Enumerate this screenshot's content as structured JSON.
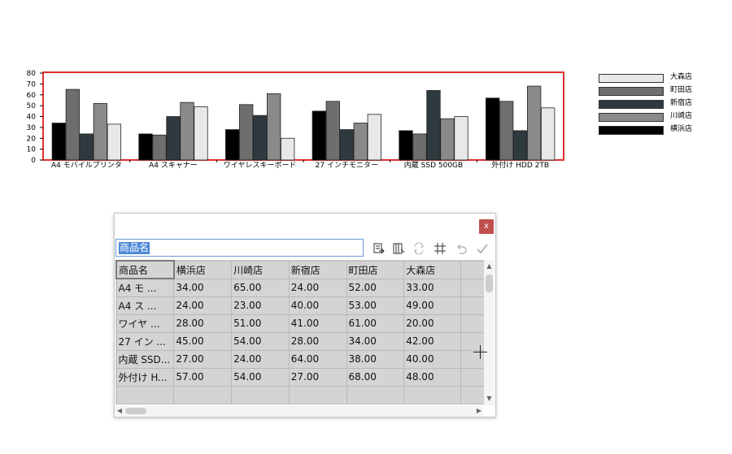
{
  "chart_data": {
    "type": "bar",
    "categories": [
      "A4 モバイルプリンタ",
      "A4 スキャナー",
      "ワイヤレスキーボード",
      "27 インチモニター",
      "内蔵 SSD 500GB",
      "外付け HDD 2TB"
    ],
    "series": [
      {
        "name": "横浜店",
        "values": [
          34,
          24,
          28,
          45,
          27,
          57
        ],
        "color": "#000000"
      },
      {
        "name": "川崎店",
        "values": [
          65,
          23,
          51,
          54,
          24,
          54
        ],
        "color": "#6e6e6e"
      },
      {
        "name": "新宿店",
        "values": [
          24,
          40,
          41,
          28,
          64,
          27
        ],
        "color": "#2f3a3f"
      },
      {
        "name": "町田店",
        "values": [
          52,
          53,
          61,
          34,
          38,
          68
        ],
        "color": "#8a8a8a"
      },
      {
        "name": "大森店",
        "values": [
          33,
          49,
          20,
          42,
          40,
          48
        ],
        "color": "#e8e8e8"
      }
    ],
    "yticks": [
      0,
      10,
      20,
      30,
      40,
      50,
      60,
      70,
      80
    ],
    "ylim": [
      0,
      80
    ],
    "legend_position": "right",
    "frame_color": "#e03030",
    "grid": false
  },
  "legend": {
    "items": [
      {
        "label": "大森店",
        "color": "#e8e8e8"
      },
      {
        "label": "町田店",
        "color": "#6e6e6e"
      },
      {
        "label": "新宿店",
        "color": "#2f3a3f"
      },
      {
        "label": "川崎店",
        "color": "#8a8a8a"
      },
      {
        "label": "横浜店",
        "color": "#000000"
      }
    ]
  },
  "editor": {
    "close_label": "x",
    "cell_input_value": "商品名",
    "toolbar": {
      "import_icon": "import-data-icon",
      "switch_icon": "switch-row-column-icon",
      "swap_icon": "swap-icon",
      "grid_icon": "grid-settings-icon",
      "undo_icon": "undo-icon",
      "apply_icon": "apply-check-icon"
    },
    "header": [
      "商品名",
      "横浜店",
      "川崎店",
      "新宿店",
      "町田店",
      "大森店",
      ""
    ],
    "rows": [
      [
        "A4 モバイルプリンタ",
        "34.00",
        "65.00",
        "24.00",
        "52.00",
        "33.00",
        ""
      ],
      [
        "A4 スキャナー",
        "24.00",
        "23.00",
        "40.00",
        "53.00",
        "49.00",
        ""
      ],
      [
        "ワイヤレスキーボード",
        "28.00",
        "51.00",
        "41.00",
        "61.00",
        "20.00",
        ""
      ],
      [
        "27 インチモニター",
        "45.00",
        "54.00",
        "28.00",
        "34.00",
        "42.00",
        ""
      ],
      [
        "内蔵 SSD 500GB",
        "27.00",
        "24.00",
        "64.00",
        "38.00",
        "40.00",
        ""
      ],
      [
        "外付け HDD 2TB",
        "57.00",
        "54.00",
        "27.00",
        "68.00",
        "48.00",
        ""
      ],
      [
        "",
        "",
        "",
        "",
        "",
        "",
        ""
      ]
    ],
    "display_rows": [
      [
        "A4 モ ...",
        "34.00",
        "65.00",
        "24.00",
        "52.00",
        "33.00",
        ""
      ],
      [
        "A4 ス ...",
        "24.00",
        "23.00",
        "40.00",
        "53.00",
        "49.00",
        ""
      ],
      [
        "ワイヤ ...",
        "28.00",
        "51.00",
        "41.00",
        "61.00",
        "20.00",
        ""
      ],
      [
        "27 イン ...",
        "45.00",
        "54.00",
        "28.00",
        "34.00",
        "42.00",
        ""
      ],
      [
        "内蔵 SSD...",
        "27.00",
        "24.00",
        "64.00",
        "38.00",
        "40.00",
        ""
      ],
      [
        "外付け H...",
        "57.00",
        "54.00",
        "27.00",
        "68.00",
        "48.00",
        ""
      ],
      [
        "",
        "",
        "",
        "",
        "",
        "",
        ""
      ]
    ]
  }
}
